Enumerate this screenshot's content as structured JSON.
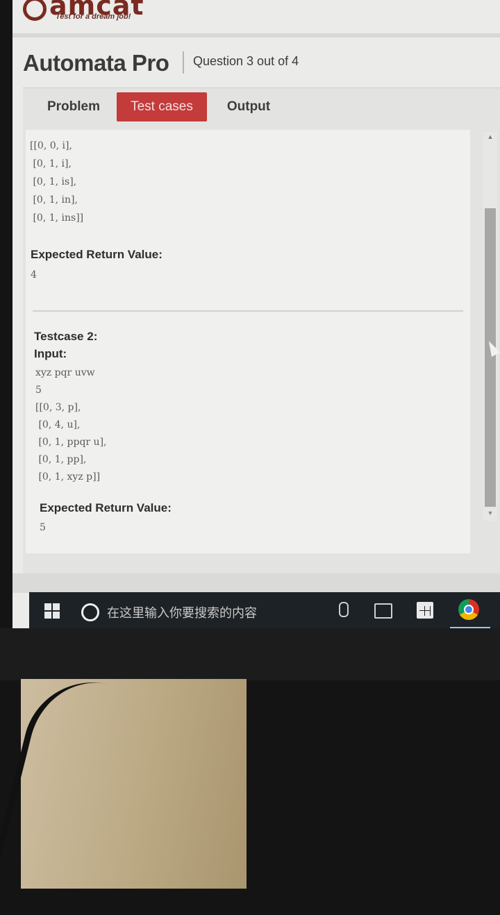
{
  "brand": {
    "logo": "amcat",
    "tagline": "Test for a dream job!"
  },
  "header": {
    "title": "Automata Pro",
    "question_count": "Question 3 out of 4"
  },
  "tabs": [
    "Problem",
    "Test cases",
    "Output"
  ],
  "active_tab": "Test cases",
  "testcase1": {
    "input_tail": "[[0, 0, i],\n [0, 1, i],\n [0, 1, is],\n [0, 1, in],\n [0, 1, ins]]",
    "expected_label": "Expected Return Value:",
    "expected_value": "4"
  },
  "testcase2": {
    "title": "Testcase 2:",
    "input_label": "Input:",
    "input": "xyz pqr uvw\n5\n[[0, 3, p],\n [0, 4, u],\n [0, 1, ppqr u],\n [0, 1, pp],\n [0, 1, xyz p]]",
    "expected_label": "Expected Return Value:",
    "expected_value": "5"
  },
  "taskbar": {
    "search_placeholder": "在这里输入你要搜索的内容"
  },
  "icons": [
    "windows-start-icon",
    "cortana-icon",
    "microphone-icon",
    "task-view-icon",
    "store-icon",
    "chrome-icon",
    "scroll-up-icon",
    "scroll-down-icon",
    "mouse-cursor-icon"
  ]
}
